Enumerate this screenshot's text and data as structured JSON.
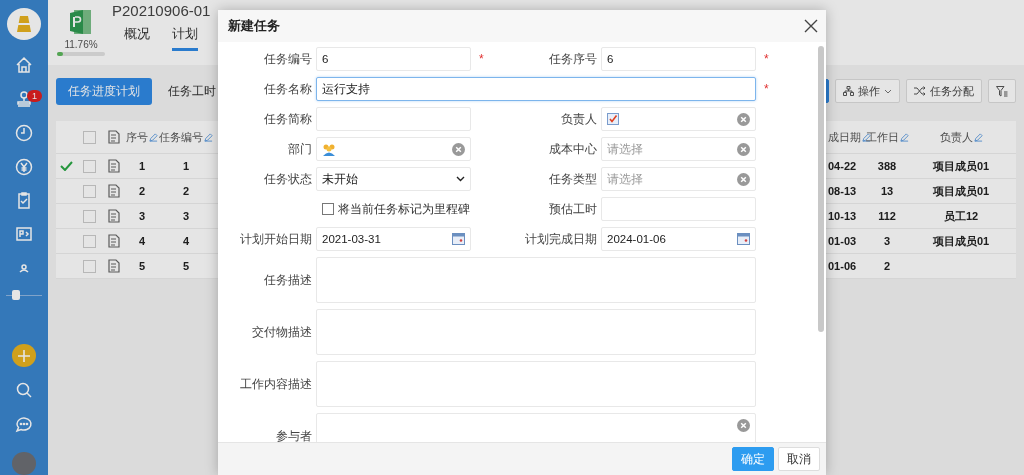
{
  "sidebar": {
    "items": [
      {
        "kind": "home"
      },
      {
        "kind": "stamp",
        "badge": "1"
      },
      {
        "kind": "clock"
      },
      {
        "kind": "yen"
      },
      {
        "kind": "clipboard"
      },
      {
        "kind": "project"
      },
      {
        "kind": "person"
      }
    ],
    "bottom": [
      {
        "kind": "add"
      },
      {
        "kind": "search"
      },
      {
        "kind": "chat"
      },
      {
        "kind": "avatar"
      }
    ]
  },
  "project": {
    "code": "P20210906-01",
    "progress": "11.76%",
    "level": 0.1176
  },
  "tabs": [
    {
      "label": "概况",
      "selected": false
    },
    {
      "label": "计划",
      "selected": true
    }
  ],
  "toolbar": {
    "views": [
      {
        "label": "任务进度计划",
        "selected": true
      },
      {
        "label": "任务工时",
        "selected": false
      }
    ],
    "actions": [
      {
        "kind": "primary"
      },
      {
        "kind": "menu",
        "label": "操作"
      },
      {
        "kind": "shuffle",
        "label": "任务分配"
      },
      {
        "kind": "filter"
      }
    ]
  },
  "table": {
    "all_checked": false,
    "columns_left": [
      "序号",
      "任务编号"
    ],
    "columns_right": [
      "成日期",
      "工作日",
      "负责人"
    ],
    "rows": [
      {
        "marked": true,
        "checked": false,
        "index": "1",
        "code": "1",
        "date": "04-22",
        "days": "388",
        "owner": "项目成员01"
      },
      {
        "marked": false,
        "checked": false,
        "index": "2",
        "code": "2",
        "date": "08-13",
        "days": "13",
        "owner": "项目成员01"
      },
      {
        "marked": false,
        "checked": false,
        "index": "3",
        "code": "3",
        "date": "10-13",
        "days": "112",
        "owner": "员工12"
      },
      {
        "marked": false,
        "checked": false,
        "index": "4",
        "code": "4",
        "date": "01-03",
        "days": "3",
        "owner": "项目成员01"
      },
      {
        "marked": false,
        "checked": false,
        "index": "5",
        "code": "5",
        "date": "01-06",
        "days": "2"
      }
    ]
  },
  "dialog": {
    "title": "新建任务",
    "required_mark": "*",
    "rows": [
      [
        {
          "label": "任务编号",
          "kind": "text",
          "value": "6",
          "required": true,
          "focused": false
        },
        {
          "label": "任务序号",
          "kind": "text",
          "value": "6",
          "required": true,
          "focused": false
        }
      ],
      [
        {
          "label": "任务名称",
          "kind": "wide-text",
          "value": "运行支持",
          "required": true,
          "focused": true
        }
      ],
      [
        {
          "label": "任务简称",
          "kind": "text",
          "required": false,
          "focused": false
        },
        {
          "label": "负责人",
          "kind": "user-picker",
          "required": false,
          "focused": false
        }
      ],
      [
        {
          "label": "部门",
          "kind": "group-picker",
          "required": false,
          "focused": false
        },
        {
          "label": "成本中心",
          "kind": "picker",
          "placeholder": "请选择",
          "required": false,
          "focused": false
        }
      ],
      [
        {
          "label": "任务状态",
          "kind": "select",
          "value": "未开始",
          "required": false,
          "focused": false
        },
        {
          "label": "任务类型",
          "kind": "picker",
          "placeholder": "请选择",
          "required": false,
          "focused": false
        }
      ],
      [
        {
          "label": "将当前任务标记为里程碑",
          "kind": "checkbox",
          "checked": false
        },
        {
          "label": "预估工时",
          "kind": "text",
          "required": false,
          "focused": false
        }
      ],
      [
        {
          "label": "计划开始日期",
          "kind": "date",
          "value": "2021-03-31",
          "required": false,
          "focused": false
        },
        {
          "label": "计划完成日期",
          "kind": "date",
          "value": "2024-01-06",
          "required": false,
          "focused": false
        }
      ],
      [
        {
          "label": "任务描述",
          "kind": "textarea",
          "required": false,
          "focused": false
        }
      ],
      [
        {
          "label": "交付物描述",
          "kind": "textarea",
          "required": false,
          "focused": false
        }
      ],
      [
        {
          "label": "工作内容描述",
          "kind": "textarea",
          "required": false,
          "focused": false
        }
      ],
      [
        {
          "label": "参与者",
          "kind": "textarea-picker",
          "required": false,
          "focused": false
        }
      ]
    ],
    "buttons": [
      {
        "label": "确定",
        "kind": "primary"
      },
      {
        "label": "取消",
        "kind": "default"
      }
    ]
  }
}
